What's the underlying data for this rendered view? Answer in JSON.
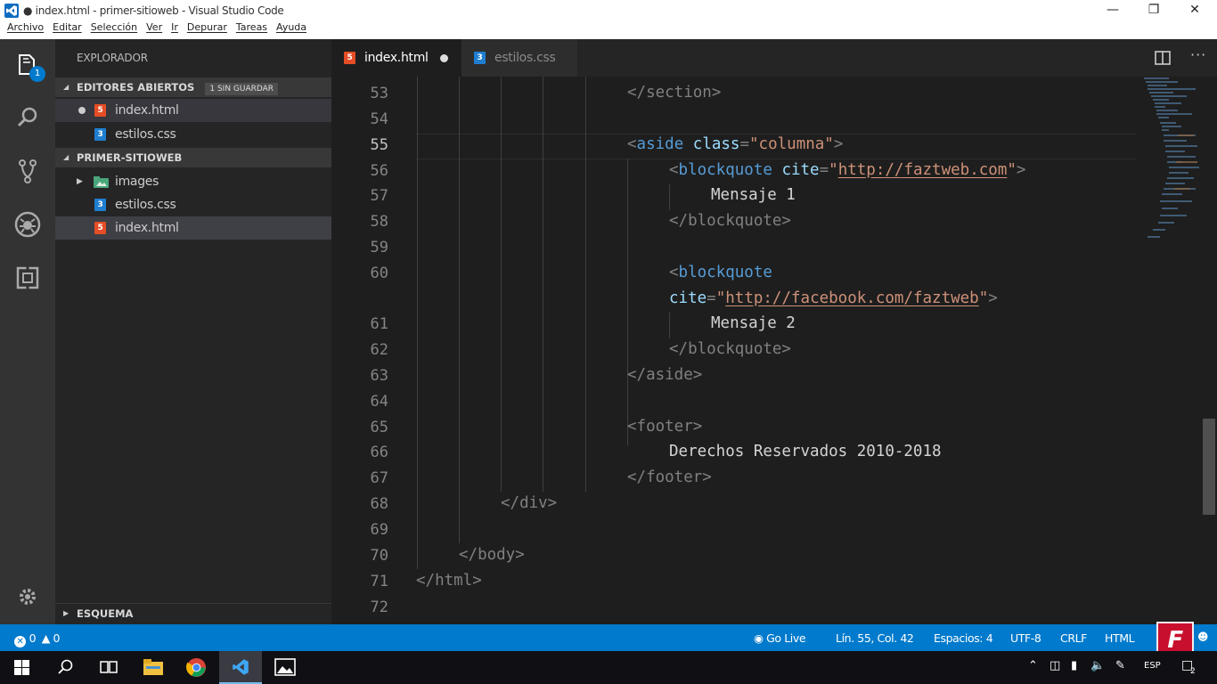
{
  "window": {
    "title": "● index.html - primer-sitioweb - Visual Studio Code"
  },
  "menu": [
    "Archivo",
    "Editar",
    "Selección",
    "Ver",
    "Ir",
    "Depurar",
    "Tareas",
    "Ayuda"
  ],
  "activity_bar": {
    "explorer_badge": "1"
  },
  "sidebar": {
    "title": "EXPLORADOR",
    "open_editors": {
      "label": "EDITORES ABIERTOS",
      "badge": "1 SIN GUARDAR",
      "files": [
        "index.html",
        "estilos.css"
      ]
    },
    "project": {
      "label": "PRIMER-SITIOWEB",
      "items": [
        "images",
        "estilos.css",
        "index.html"
      ]
    },
    "outline": {
      "label": "ESQUEMA"
    }
  },
  "tabs": [
    {
      "label": "index.html",
      "dirty": true,
      "active": true
    },
    {
      "label": "estilos.css",
      "dirty": false,
      "active": false
    }
  ],
  "editor": {
    "line_numbers": [
      "53",
      "54",
      "55",
      "56",
      "57",
      "58",
      "59",
      "60",
      "",
      "61",
      "62",
      "63",
      "64",
      "65",
      "66",
      "67",
      "68",
      "69",
      "70",
      "71",
      "72"
    ],
    "current_line": "55",
    "code": {
      "l53": "</section>",
      "l55_tag": "aside",
      "l55_attr": "class",
      "l55_val": "\"columna\"",
      "l56_tag": "blockquote",
      "l56_attr": "cite",
      "l56_url": "http://faztweb.com",
      "l57": "Mensaje 1",
      "l58": "</blockquote>",
      "l60_tag": "blockquote",
      "l60b_attr": "cite",
      "l60b_url": "http://facebook.com/faztweb",
      "l61": "Mensaje 2",
      "l62": "</blockquote>",
      "l63": "</aside>",
      "l65": "<footer>",
      "l66": "Derechos Reservados 2010-2018",
      "l67": "</footer>",
      "l68": "</div>",
      "l70": "</body>",
      "l71": "</html>"
    }
  },
  "statusbar": {
    "errors": "0",
    "warnings": "0",
    "golive": "Go Live",
    "position": "Lín. 55, Col. 42",
    "spaces": "Espacios: 4",
    "encoding": "UTF-8",
    "eol": "CRLF",
    "language": "HTML"
  },
  "taskbar": {
    "lang": "ESP",
    "notifications": "2"
  }
}
